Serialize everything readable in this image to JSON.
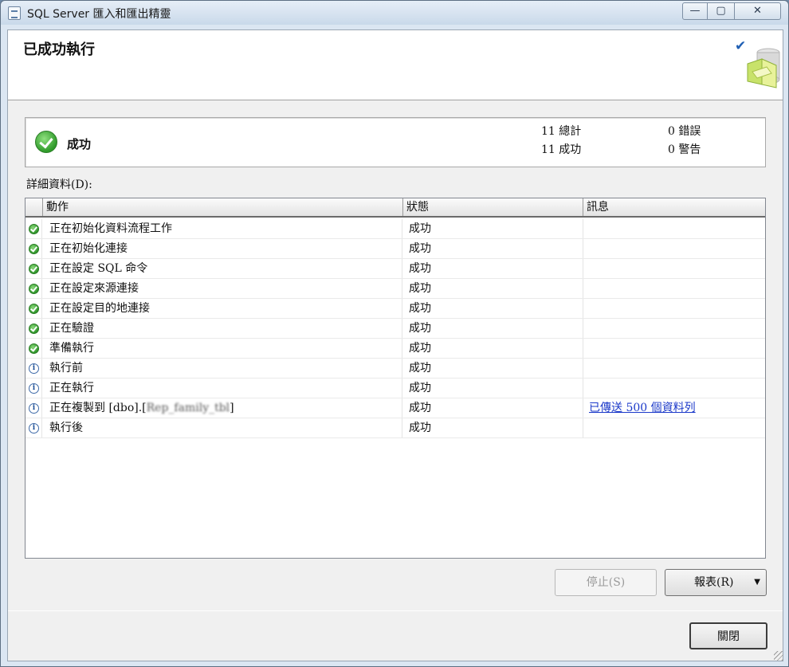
{
  "window": {
    "title": "SQL Server 匯入和匯出精靈",
    "controls": {
      "minimize": "—",
      "maximize": "▢",
      "close": "✕"
    }
  },
  "header": {
    "title": "已成功執行",
    "icon": "checkmark-banner-icon"
  },
  "summary": {
    "status": "成功",
    "total_label": "11 總計",
    "success_label": "11 成功",
    "error_label": "0 錯誤",
    "warning_label": "0 警告"
  },
  "details_label": "詳細資料(D):",
  "grid": {
    "columns": [
      "動作",
      "狀態",
      "訊息"
    ],
    "rows": [
      {
        "icon": "success",
        "action": "正在初始化資料流程工作",
        "status": "成功",
        "message": ""
      },
      {
        "icon": "success",
        "action": "正在初始化連接",
        "status": "成功",
        "message": ""
      },
      {
        "icon": "success",
        "action": "正在設定 SQL 命令",
        "status": "成功",
        "message": ""
      },
      {
        "icon": "success",
        "action": "正在設定來源連接",
        "status": "成功",
        "message": ""
      },
      {
        "icon": "success",
        "action": "正在設定目的地連接",
        "status": "成功",
        "message": ""
      },
      {
        "icon": "success",
        "action": "正在驗證",
        "status": "成功",
        "message": ""
      },
      {
        "icon": "success",
        "action": "準備執行",
        "status": "成功",
        "message": ""
      },
      {
        "icon": "info",
        "action": "執行前",
        "status": "成功",
        "message": ""
      },
      {
        "icon": "info",
        "action": "正在執行",
        "status": "成功",
        "message": ""
      },
      {
        "icon": "info",
        "action": "正在複製到 [dbo].[",
        "action_blurred": "Rep_family_tbl",
        "action_suffix": "]",
        "status": "成功",
        "message": "已傳送 500 個資料列"
      },
      {
        "icon": "info",
        "action": "執行後",
        "status": "成功",
        "message": ""
      }
    ]
  },
  "buttons": {
    "stop": "停止(S)",
    "report": "報表(R)",
    "close": "關閉"
  }
}
